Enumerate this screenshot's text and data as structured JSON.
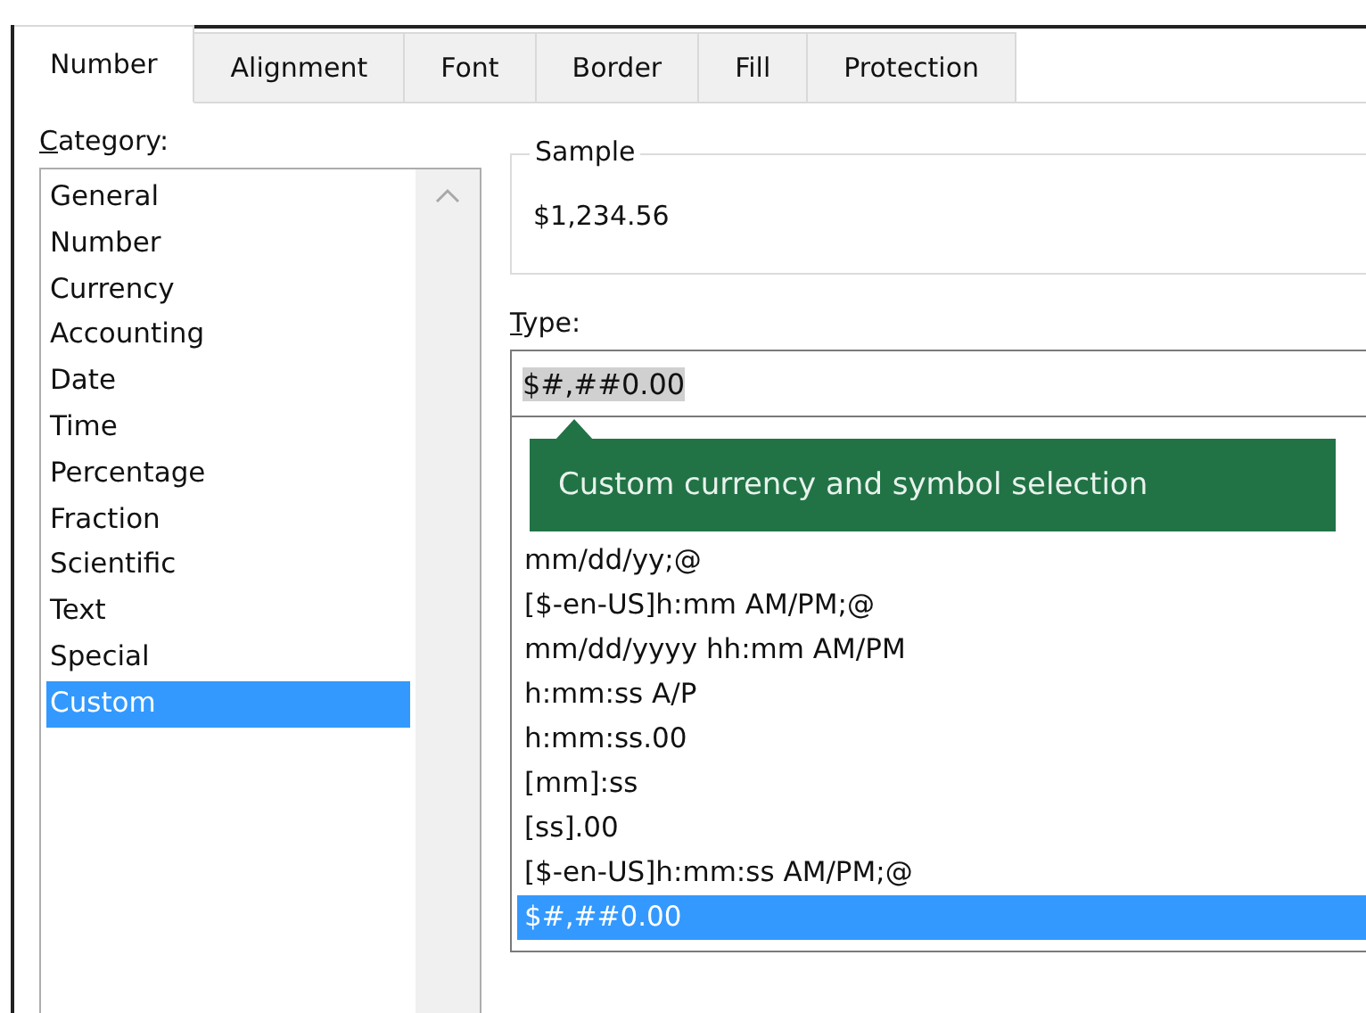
{
  "tabs": [
    {
      "label": "Number",
      "selected": true
    },
    {
      "label": "Alignment",
      "selected": false
    },
    {
      "label": "Font",
      "selected": false
    },
    {
      "label": "Border",
      "selected": false
    },
    {
      "label": "Fill",
      "selected": false
    },
    {
      "label": "Protection",
      "selected": false
    }
  ],
  "category": {
    "label": "Category:",
    "items": [
      {
        "label": "General",
        "selected": false
      },
      {
        "label": "Number",
        "selected": false
      },
      {
        "label": "Currency",
        "selected": false
      },
      {
        "label": "Accounting",
        "selected": false
      },
      {
        "label": "Date",
        "selected": false
      },
      {
        "label": "Time",
        "selected": false
      },
      {
        "label": "Percentage",
        "selected": false
      },
      {
        "label": "Fraction",
        "selected": false
      },
      {
        "label": "Scientific",
        "selected": false
      },
      {
        "label": "Text",
        "selected": false
      },
      {
        "label": "Special",
        "selected": false
      },
      {
        "label": "Custom",
        "selected": true
      }
    ]
  },
  "sample": {
    "label": "Sample",
    "value": "$1,234.56"
  },
  "type": {
    "label": "Type:",
    "value": "$#,##0.00",
    "tooltip": "Custom currency and symbol selection",
    "items": [
      {
        "label": "mm/dd/yy;@",
        "selected": false
      },
      {
        "label": "[$-en-US]h:mm AM/PM;@",
        "selected": false
      },
      {
        "label": "mm/dd/yyyy hh:mm AM/PM",
        "selected": false
      },
      {
        "label": "h:mm:ss A/P",
        "selected": false
      },
      {
        "label": "h:mm:ss.00",
        "selected": false
      },
      {
        "label": "[mm]:ss",
        "selected": false
      },
      {
        "label": "[ss].00",
        "selected": false
      },
      {
        "label": "[$-en-US]h:mm:ss AM/PM;@",
        "selected": false
      },
      {
        "label": "$#,##0.00",
        "selected": true
      }
    ]
  }
}
